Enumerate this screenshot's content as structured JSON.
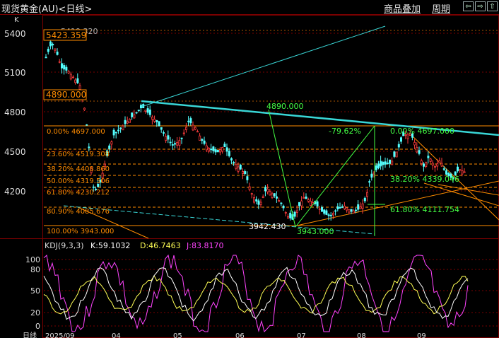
{
  "window": {
    "title": "现货黄金(AU)<日线>",
    "add_product_label": "商品叠加",
    "period_label": "周期",
    "nav_buttons": [
      "⇦",
      "⇨",
      "⇧"
    ]
  },
  "colors": {
    "background": "#000000",
    "grid": "#7a0000",
    "candle_up": "#ff3c3c",
    "candle_down": "#54ffff",
    "fib_line": "#ff8c00",
    "trend_line": "#39d6d6",
    "green_text": "#44ff44",
    "k_line": "#ffffff",
    "d_line": "#ffff55",
    "j_line": "#ff44ff"
  },
  "price_panel": {
    "label": "K",
    "y_ticks": [
      "5400",
      "5100",
      "4800",
      "4500",
      "4200"
    ],
    "callouts": {
      "top_value": "5423.359",
      "top_value_hidden": "5419.320",
      "mid_value": "4890.000"
    },
    "fib_left": [
      {
        "label": "0.00%",
        "value": "4697.000"
      },
      {
        "label": "23.60%",
        "value": "4519.308"
      },
      {
        "label": "38.20%",
        "value": "4408.860"
      },
      {
        "label": "50.00%",
        "value": "4319.506"
      },
      {
        "label": "61.80%",
        "value": "4230.212"
      },
      {
        "label": "80.90%",
        "value": "4085.676"
      },
      {
        "label": "100.00%",
        "value": "3943.000"
      }
    ],
    "fib_right": [
      {
        "label": "0.00%",
        "value": "4697.000"
      },
      {
        "label": "38.20%",
        "value": "4339.046"
      },
      {
        "label": "61.80%",
        "value": "4111.754"
      }
    ],
    "annotations": {
      "peak_label": "4890.000",
      "low_label_white": "3942.430",
      "low_label_green": "3943.000",
      "pct_label": "-79.62%"
    }
  },
  "indicator_panel": {
    "name": "KDJ(9,3,3)",
    "k_text": "K:59.1032",
    "d_text": "D:46.7463",
    "j_text": "J:83.8170",
    "y_ticks": [
      "100",
      "80",
      "50",
      "20",
      "0"
    ]
  },
  "x_axis": {
    "label": "日线",
    "ticks": [
      "2025/09",
      "04",
      "05",
      "06",
      "07",
      "08",
      "09"
    ]
  },
  "chart_data": {
    "type": "candlestick",
    "title": "现货黄金(AU)<日线>",
    "series": [
      {
        "name": "K",
        "values_note": "KDJ(9,3,3) K:59.1032"
      },
      {
        "name": "D",
        "values_note": "D:46.7463"
      },
      {
        "name": "J",
        "values_note": "J:83.8170"
      }
    ],
    "ylim": [
      3900,
      5450
    ],
    "key_levels": [
      5423.359,
      4890.0,
      4697.0,
      4519.308,
      4408.86,
      4319.506,
      4230.212,
      4085.676,
      3943.0
    ]
  }
}
